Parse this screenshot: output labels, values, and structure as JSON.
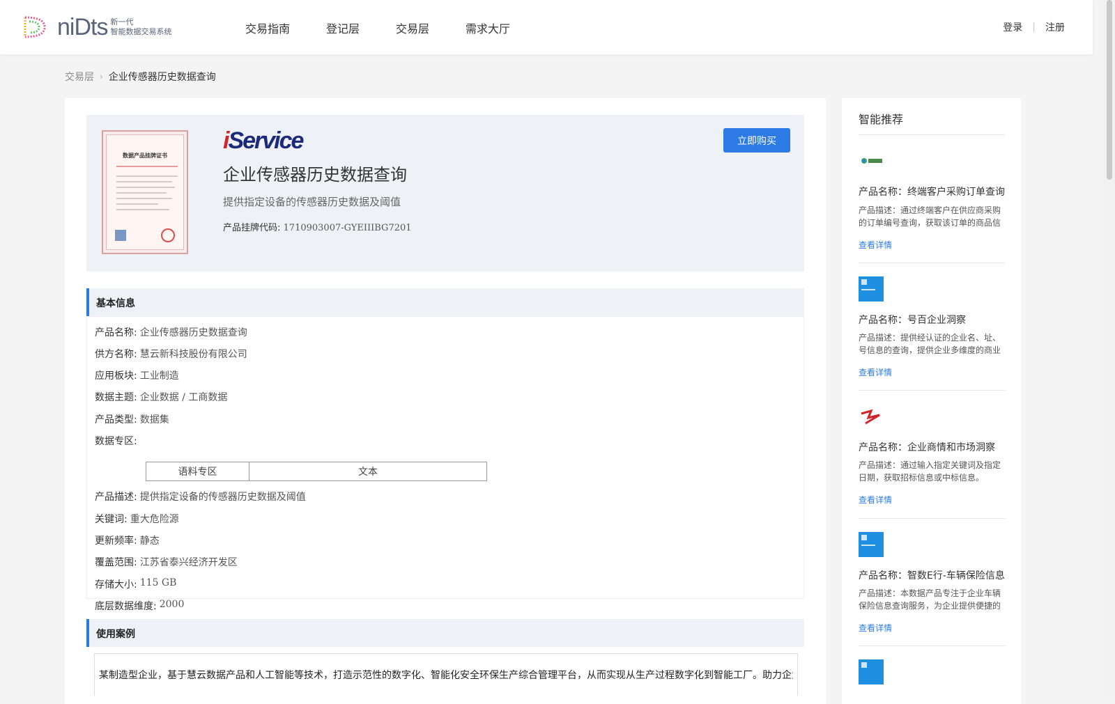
{
  "header": {
    "logo_word": "niDts",
    "logo_sub_1": "新一代",
    "logo_sub_2": "智能数据交易系统",
    "nav": [
      "交易指南",
      "登记层",
      "交易层",
      "需求大厅"
    ],
    "login": "登录",
    "register": "注册"
  },
  "breadcrumb": {
    "parent": "交易层",
    "current": "企业传感器历史数据查询"
  },
  "hero": {
    "brand": "iService",
    "title": "企业传感器历史数据查询",
    "desc": "提供指定设备的传感器历史数据及阈值",
    "code_label": "产品挂牌代码:",
    "code_value": "1710903007-GYEIIIBG7201",
    "buy_label": "立即购买",
    "cert_title": "数据产品挂牌证书"
  },
  "basic": {
    "heading": "基本信息",
    "rows": [
      {
        "k": "产品名称:",
        "v": "企业传感器历史数据查询"
      },
      {
        "k": "供方名称:",
        "v": "慧云新科技股份有限公司"
      },
      {
        "k": "应用板块:",
        "v": "工业制造"
      },
      {
        "k": "数据主题:",
        "v": "企业数据 / 工商数据"
      },
      {
        "k": "产品类型:",
        "v": "数据集"
      },
      {
        "k": "数据专区:",
        "v": ""
      },
      {
        "k": "产品描述:",
        "v": "提供指定设备的传感器历史数据及阈值"
      },
      {
        "k": "关键词:",
        "v": "重大危险源"
      },
      {
        "k": "更新频率:",
        "v": "静态"
      },
      {
        "k": "覆盖范围:",
        "v": "江苏省泰兴经济开发区"
      },
      {
        "k": "存储大小:",
        "v": "115 GB"
      },
      {
        "k": "底层数据维度:",
        "v": "2000"
      }
    ],
    "zone_cells": [
      "语料专区",
      "文本"
    ]
  },
  "cases": {
    "heading": "使用案例",
    "text": "某制造型企业，基于慧云数据产品和人工智能等技术，打造示范性的数字化、智能化安全环保生产综合管理平台，从而实现从生产过程数字化到智能工厂。助力企业"
  },
  "sidebar": {
    "title": "智能推荐",
    "items": [
      {
        "name": "产品名称：终端客户采购订单查询服务",
        "desc": "产品描述：通过终端客户在供应商采购的订单编号查询，获取该订单的商品信息",
        "link": "查看详情",
        "logo": "green-logo-icon"
      },
      {
        "name": "产品名称：号百企业洞察",
        "desc": "产品描述：提供经认证的企业名、址、号信息的查询，提供企业多维度的商业信息",
        "link": "查看详情",
        "logo": "blue-app-icon"
      },
      {
        "name": "产品名称：企业商情和市场洞察",
        "desc": "产品描述：通过输入指定关键词及指定日期，获取招标信息或中标信息。",
        "link": "查看详情",
        "logo": "red-logo-icon"
      },
      {
        "name": "产品名称：智数E行-车辆保险信息查询",
        "desc": "产品描述：本数据产品专注于企业车辆保险信息查询服务，为企业提供便捷的查询",
        "link": "查看详情",
        "logo": "blue-app-icon"
      }
    ]
  },
  "colors": {
    "accent": "#2c7be5",
    "panel": "#eef1f6",
    "page_bg": "#f4f4f4"
  }
}
